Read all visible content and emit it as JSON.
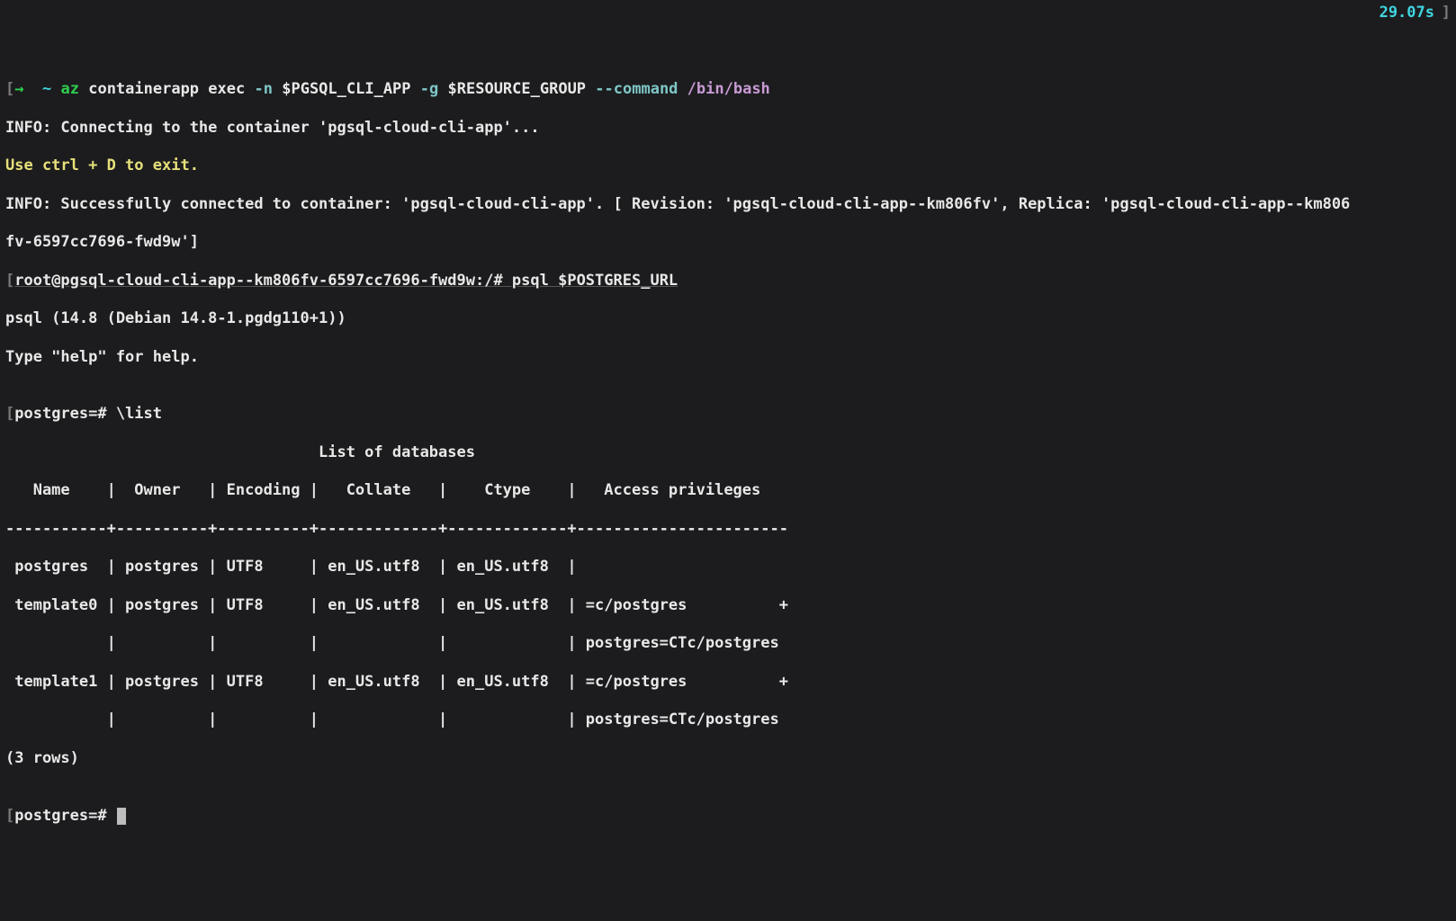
{
  "top": {
    "left_bracket": "[",
    "arrow": "→",
    "tilde": "~",
    "cmd": "az",
    "sub": "containerapp",
    "verb": "exec",
    "flag_n": "-n",
    "var_n": "$PGSQL_CLI_APP",
    "flag_g": "-g",
    "var_g": "$RESOURCE_GROUP",
    "flag_cmd": "--command",
    "bash": "/bin/bash",
    "time": "29.07s",
    "right_bracket": "]"
  },
  "lines": {
    "connecting": "INFO: Connecting to the container 'pgsql-cloud-cli-app'...",
    "exit_hint": "Use ctrl + D to exit.",
    "connected_a": "INFO: Successfully connected to container: 'pgsql-cloud-cli-app'. [ Revision: 'pgsql-cloud-cli-app--km806fv', Replica: 'pgsql-cloud-cli-app--km806",
    "connected_b": "fv-6597cc7696-fwd9w']",
    "shell_prompt": "root@pgsql-cloud-cli-app--km806fv-6597cc7696-fwd9w:/# psql $POSTGRES_URL",
    "psql_ver": "psql (14.8 (Debian 14.8-1.pgdg110+1))",
    "help": "Type \"help\" for help.",
    "blank": "",
    "pg_prompt1_a": "[",
    "pg_prompt1_b": "postgres=# \\list",
    "title": "                                  List of databases",
    "header": "   Name    |  Owner   | Encoding |   Collate   |    Ctype    |   Access privileges   ",
    "rule": "-----------+----------+----------+-------------+-------------+-----------------------",
    "row1": " postgres  | postgres | UTF8     | en_US.utf8  | en_US.utf8  | ",
    "row2a": " template0 | postgres | UTF8     | en_US.utf8  | en_US.utf8  | =c/postgres          +",
    "row2b": "           |          |          |             |             | postgres=CTc/postgres",
    "row3a": " template1 | postgres | UTF8     | en_US.utf8  | en_US.utf8  | =c/postgres          +",
    "row3b": "           |          |          |             |             | postgres=CTc/postgres",
    "rows": "(3 rows)",
    "pg_prompt2_a": "[",
    "pg_prompt2_b": "postgres=# "
  },
  "chart_data": {
    "type": "table",
    "title": "List of databases",
    "columns": [
      "Name",
      "Owner",
      "Encoding",
      "Collate",
      "Ctype",
      "Access privileges"
    ],
    "rows": [
      {
        "Name": "postgres",
        "Owner": "postgres",
        "Encoding": "UTF8",
        "Collate": "en_US.utf8",
        "Ctype": "en_US.utf8",
        "Access privileges": ""
      },
      {
        "Name": "template0",
        "Owner": "postgres",
        "Encoding": "UTF8",
        "Collate": "en_US.utf8",
        "Ctype": "en_US.utf8",
        "Access privileges": "=c/postgres, postgres=CTc/postgres"
      },
      {
        "Name": "template1",
        "Owner": "postgres",
        "Encoding": "UTF8",
        "Collate": "en_US.utf8",
        "Ctype": "en_US.utf8",
        "Access privileges": "=c/postgres, postgres=CTc/postgres"
      }
    ],
    "row_count_label": "(3 rows)"
  }
}
